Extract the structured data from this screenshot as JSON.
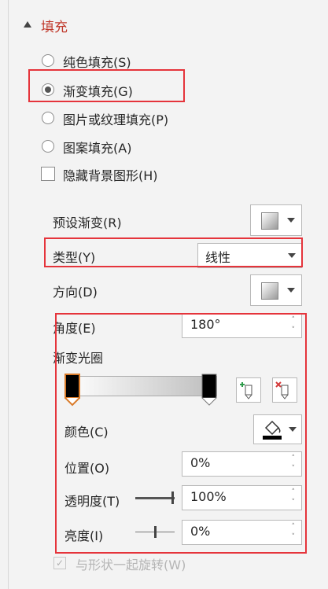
{
  "section": {
    "title": "填充"
  },
  "fill_options": [
    {
      "label": "纯色填充(S)",
      "selected": false
    },
    {
      "label": "渐变填充(G)",
      "selected": true
    },
    {
      "label": "图片或纹理填充(P)",
      "selected": false
    },
    {
      "label": "图案填充(A)",
      "selected": false
    }
  ],
  "hide_background": {
    "label": "隐藏背景图形(H)",
    "checked": false
  },
  "preset": {
    "label": "预设渐变(R)",
    "icon": "gradient-swatch-icon"
  },
  "type": {
    "label": "类型(Y)",
    "value": "线性"
  },
  "direction": {
    "label": "方向(D)",
    "icon": "gradient-direction-icon"
  },
  "angle": {
    "label": "角度(E)",
    "value": "180°"
  },
  "gradient_stops": {
    "label": "渐变光圈",
    "add_icon": "add-stop-icon",
    "remove_icon": "remove-stop-icon"
  },
  "color": {
    "label": "颜色(C)",
    "icon": "paint-bucket-icon",
    "swatch": "#000000"
  },
  "position": {
    "label": "位置(O)",
    "value": "0%"
  },
  "transparency": {
    "label": "透明度(T)",
    "value": "100%",
    "slider_fraction": 1.0
  },
  "brightness": {
    "label": "亮度(I)",
    "value": "0%",
    "slider_fraction": 0.5
  },
  "rotate_with_shape": {
    "label": "与形状一起旋转(W)",
    "checked": true,
    "disabled": true
  },
  "colors": {
    "accent_red": "#e5343b",
    "header_red": "#c0392b"
  }
}
